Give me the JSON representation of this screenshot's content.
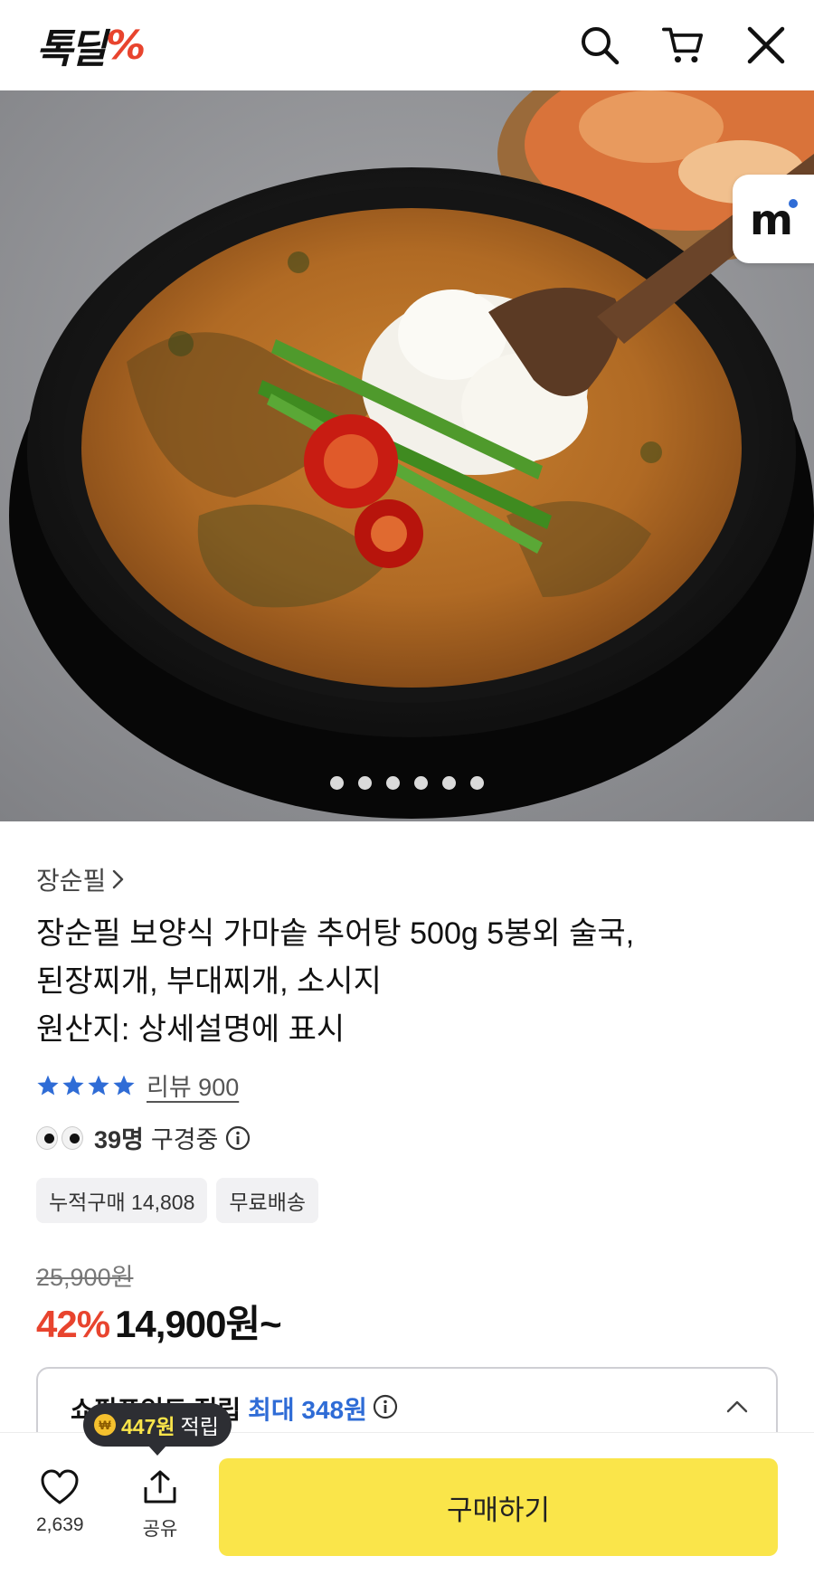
{
  "header": {
    "logo_text": "톡딜",
    "logo_symbol": "%",
    "icons": [
      "search-icon",
      "cart-icon",
      "close-icon"
    ]
  },
  "hero": {
    "badge_letter": "m",
    "image_count": 6,
    "active_index": 0
  },
  "product": {
    "brand": "장순필",
    "title_lines": [
      "장순필 보양식 가마솥 추어탕 500g 5봉외 술국,",
      "된장찌개, 부대찌개, 소시지",
      "원산지: 상세설명에 표시"
    ],
    "rating_stars": 4,
    "review_label": "리뷰 900",
    "viewers_count": "39명",
    "viewers_suffix": "구경중",
    "tags": [
      "누적구매 14,808",
      "무료배송"
    ],
    "original_price": "25,900원",
    "discount": "42%",
    "price": "14,900원~"
  },
  "points": {
    "label": "쇼핑포인트 적립",
    "max_label": "최대 348원"
  },
  "tooltip": {
    "amount": "447원",
    "suffix": "적립"
  },
  "bottom_bar": {
    "like_count": "2,639",
    "share_label": "공유",
    "buy_label": "구매하기"
  },
  "colors": {
    "accent_red": "#e8442e",
    "buy_yellow": "#fae54a",
    "star_blue": "#2f6cd6"
  }
}
